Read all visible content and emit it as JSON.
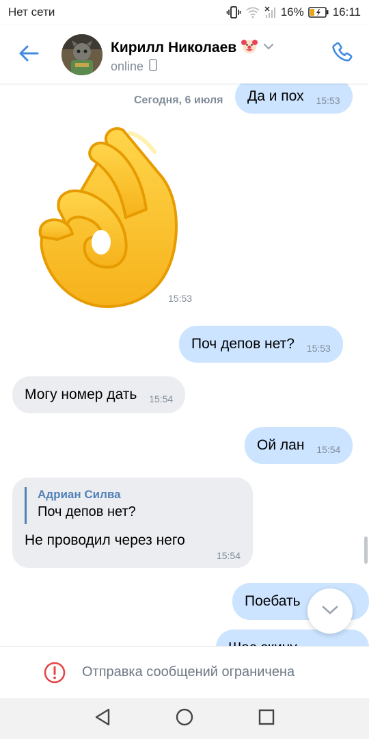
{
  "status_bar": {
    "network": "Нет сети",
    "battery": "16%",
    "time": "16:11"
  },
  "header": {
    "contact_name": "Кирилл Николаев",
    "status": "online",
    "icons": [
      "back-arrow-icon",
      "clown-emoji-icon",
      "chevron-down-icon",
      "mobile-phone-icon",
      "phone-call-icon"
    ]
  },
  "chat": {
    "date_label": "Сегодня, 6 июля",
    "messages": [
      {
        "id": "m1",
        "direction": "out",
        "text": "Да и пох",
        "time": "15:53"
      },
      {
        "id": "m2",
        "direction": "in",
        "type": "sticker",
        "sticker": "ok-hand-sticker",
        "time": "15:53"
      },
      {
        "id": "m3",
        "direction": "out",
        "text": "Поч депов нет?",
        "time": "15:53"
      },
      {
        "id": "m4",
        "direction": "in",
        "text": "Могу номер дать",
        "time": "15:54"
      },
      {
        "id": "m5",
        "direction": "out",
        "text": "Ой лан",
        "time": "15:54"
      },
      {
        "id": "m6",
        "direction": "in",
        "reply": {
          "author": "Адриан Силва",
          "text": "Поч депов нет?"
        },
        "text": "Не проводил через него",
        "time": "15:54"
      },
      {
        "id": "m7",
        "direction": "out",
        "text": "Поебать",
        "time": ""
      },
      {
        "id": "m8",
        "direction": "out",
        "text": "Шас скину",
        "time": ""
      }
    ]
  },
  "restriction": {
    "text": "Отправка сообщений ограничена",
    "icon": "alert-circle-icon"
  },
  "navbar": {
    "icons": [
      "nav-back-icon",
      "nav-home-icon",
      "nav-recents-icon"
    ]
  },
  "colors": {
    "accent": "#5181b8",
    "outgoing_bubble": "#cce4ff",
    "incoming_bubble": "#ebedf0",
    "meta_text": "#818c99",
    "alert": "#e64646"
  }
}
